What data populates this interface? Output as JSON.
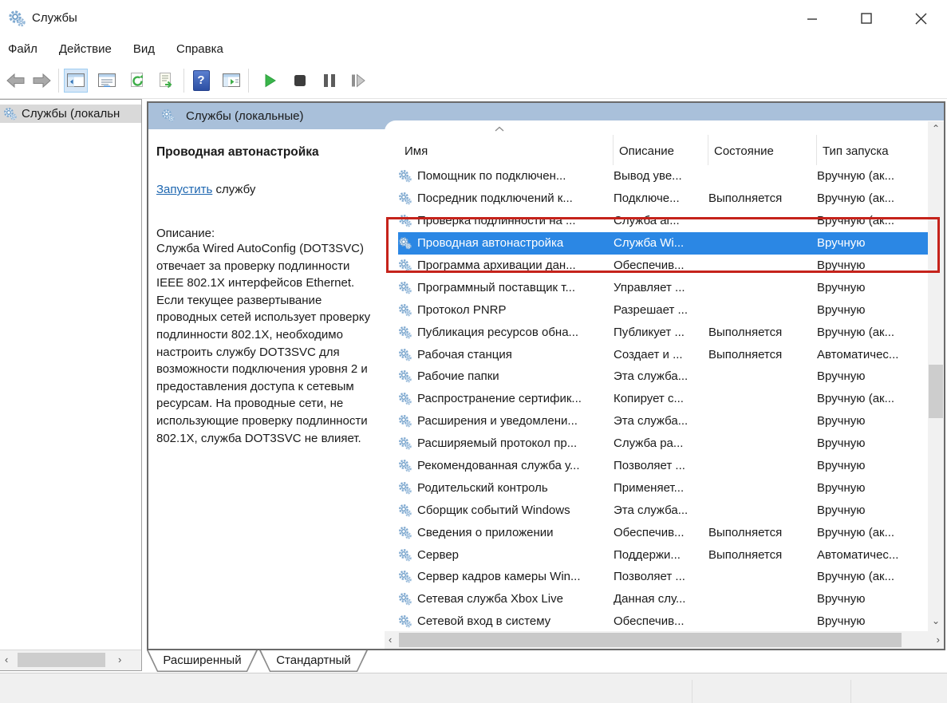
{
  "window": {
    "title": "Службы",
    "controls": {
      "minimize": "minimize",
      "maximize": "maximize",
      "close": "close"
    }
  },
  "menu": {
    "items": [
      "Файл",
      "Действие",
      "Вид",
      "Справка"
    ]
  },
  "toolbar": {
    "icons": [
      "back",
      "forward",
      "show-console-tree",
      "properties",
      "refresh",
      "export-list",
      "help",
      "show-action-pane",
      "start-service",
      "stop-service",
      "pause-service",
      "restart-service"
    ]
  },
  "tree": {
    "items": [
      {
        "label": "Службы (локальн"
      }
    ]
  },
  "panel": {
    "header": "Службы (локальные)",
    "details": {
      "service_title": "Проводная автонастройка",
      "action_link": "Запустить",
      "action_suffix": " службу",
      "description_label": "Описание:",
      "description": "Служба Wired AutoConfig (DOT3SVC) отвечает за проверку подлинности IEEE 802.1X интерфейсов Ethernet. Если текущее развертывание проводных сетей использует проверку подлинности 802.1X, необходимо настроить службу DOT3SVC для возможности подключения уровня 2 и предоставления доступа к сетевым ресурсам. На проводные сети, не использующие проверку подлинности 802.1X, служба DOT3SVC не влияет."
    },
    "table": {
      "columns": [
        "Имя",
        "Описание",
        "Состояние",
        "Тип запуска"
      ],
      "selected_index": 3,
      "rows": [
        {
          "name": "Помощник по подключен...",
          "description": "Вывод уве...",
          "state": "",
          "startup": "Вручную (ак..."
        },
        {
          "name": "Посредник подключений к...",
          "description": "Подключе...",
          "state": "Выполняется",
          "startup": "Вручную (ак..."
        },
        {
          "name": "Проверка подлинности на ...",
          "description": "Служба аг...",
          "state": "",
          "startup": "Вручную (ак..."
        },
        {
          "name": "Проводная автонастройка",
          "description": "Служба Wi...",
          "state": "",
          "startup": "Вручную"
        },
        {
          "name": "Программа архивации дан...",
          "description": "Обеспечив...",
          "state": "",
          "startup": "Вручную"
        },
        {
          "name": "Программный поставщик т...",
          "description": "Управляет ...",
          "state": "",
          "startup": "Вручную"
        },
        {
          "name": "Протокол PNRP",
          "description": "Разрешает ...",
          "state": "",
          "startup": "Вручную"
        },
        {
          "name": "Публикация ресурсов обна...",
          "description": "Публикует ...",
          "state": "Выполняется",
          "startup": "Вручную (ак..."
        },
        {
          "name": "Рабочая станция",
          "description": "Создает и ...",
          "state": "Выполняется",
          "startup": "Автоматичес..."
        },
        {
          "name": "Рабочие папки",
          "description": "Эта служба...",
          "state": "",
          "startup": "Вручную"
        },
        {
          "name": "Распространение сертифик...",
          "description": "Копирует с...",
          "state": "",
          "startup": "Вручную (ак..."
        },
        {
          "name": "Расширения и уведомлени...",
          "description": "Эта служба...",
          "state": "",
          "startup": "Вручную"
        },
        {
          "name": "Расширяемый протокол пр...",
          "description": "Служба ра...",
          "state": "",
          "startup": "Вручную"
        },
        {
          "name": "Рекомендованная служба у...",
          "description": "Позволяет ...",
          "state": "",
          "startup": "Вручную"
        },
        {
          "name": "Родительский контроль",
          "description": "Применяет...",
          "state": "",
          "startup": "Вручную"
        },
        {
          "name": "Сборщик событий Windows",
          "description": "Эта служба...",
          "state": "",
          "startup": "Вручную"
        },
        {
          "name": "Сведения о приложении",
          "description": "Обеспечив...",
          "state": "Выполняется",
          "startup": "Вручную (ак..."
        },
        {
          "name": "Сервер",
          "description": "Поддержи...",
          "state": "Выполняется",
          "startup": "Автоматичес..."
        },
        {
          "name": "Сервер кадров камеры Win...",
          "description": "Позволяет ...",
          "state": "",
          "startup": "Вручную (ак..."
        },
        {
          "name": "Сетевая служба Xbox Live",
          "description": "Данная слу...",
          "state": "",
          "startup": "Вручную"
        },
        {
          "name": "Сетевой вход в систему",
          "description": "Обеспечив...",
          "state": "",
          "startup": "Вручную"
        }
      ]
    }
  },
  "tabs": {
    "items": [
      "Расширенный",
      "Стандартный"
    ],
    "active": "Расширенный"
  },
  "annotation": {
    "shape": "rectangle",
    "color": "#c5231b"
  },
  "colors": {
    "panel_header": "#a9c0da",
    "selection": "#2b87e4",
    "tree_selection": "#d9d9d9",
    "link": "#1d66b0"
  }
}
